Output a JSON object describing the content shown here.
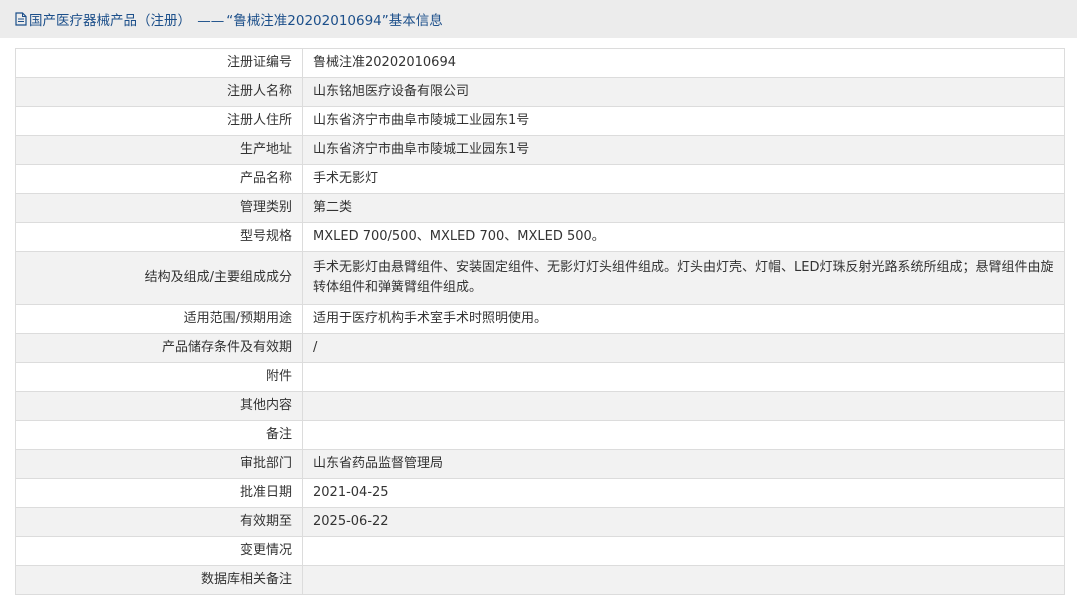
{
  "header": {
    "category": "国产医疗器械产品（注册）",
    "separator": "——",
    "registration_quoted": "“鲁械注准20202010694”",
    "suffix": "基本信息"
  },
  "rows": [
    {
      "label": "注册证编号",
      "value": "鲁械注准20202010694"
    },
    {
      "label": "注册人名称",
      "value": "山东铭旭医疗设备有限公司"
    },
    {
      "label": "注册人住所",
      "value": "山东省济宁市曲阜市陵城工业园东1号"
    },
    {
      "label": "生产地址",
      "value": "山东省济宁市曲阜市陵城工业园东1号"
    },
    {
      "label": "产品名称",
      "value": "手术无影灯"
    },
    {
      "label": "管理类别",
      "value": "第二类"
    },
    {
      "label": "型号规格",
      "value": "MXLED 700/500、MXLED 700、MXLED 500。"
    },
    {
      "label": "结构及组成/主要组成成分",
      "value": "手术无影灯由悬臂组件、安装固定组件、无影灯灯头组件组成。灯头由灯壳、灯帽、LED灯珠反射光路系统所组成；悬臂组件由旋转体组件和弹簧臂组件组成。"
    },
    {
      "label": "适用范围/预期用途",
      "value": "适用于医疗机构手术室手术时照明使用。"
    },
    {
      "label": "产品储存条件及有效期",
      "value": "/"
    },
    {
      "label": "附件",
      "value": ""
    },
    {
      "label": "其他内容",
      "value": ""
    },
    {
      "label": "备注",
      "value": ""
    },
    {
      "label": "审批部门",
      "value": "山东省药品监督管理局"
    },
    {
      "label": "批准日期",
      "value": "2021-04-25"
    },
    {
      "label": "有效期至",
      "value": "2025-06-22"
    },
    {
      "label": "变更情况",
      "value": ""
    },
    {
      "label": "数据库相关备注",
      "value": ""
    }
  ],
  "colors": {
    "title_text": "#1c4f8a",
    "title_bar_bg": "#ececec",
    "alt_row_bg": "#f2f2f2",
    "border": "#dcdcdc"
  }
}
